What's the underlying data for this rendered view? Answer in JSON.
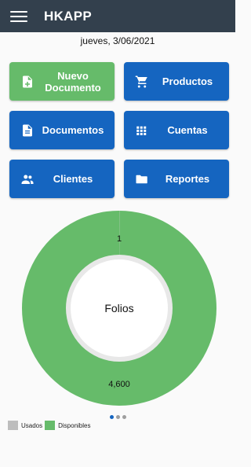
{
  "appbar": {
    "title": "HKAPP",
    "menu_icon": "hamburger-menu-icon"
  },
  "date": "jueves, 3/06/2021",
  "tiles": [
    {
      "label": "Nuevo Documento",
      "icon": "new-document-icon",
      "color": "#66bb6a"
    },
    {
      "label": "Productos",
      "icon": "shopping-cart-icon",
      "color": "#1565c0"
    },
    {
      "label": "Documentos",
      "icon": "document-icon",
      "color": "#1565c0"
    },
    {
      "label": "Cuentas",
      "icon": "grid-icon",
      "color": "#1565c0"
    },
    {
      "label": "Clientes",
      "icon": "people-icon",
      "color": "#1565c0"
    },
    {
      "label": "Reportes",
      "icon": "folder-icon",
      "color": "#1565c0"
    }
  ],
  "chart_data": {
    "type": "pie",
    "center_label": "Folios",
    "categories": [
      "Usados",
      "Disponibles"
    ],
    "values": [
      1,
      4600
    ],
    "value_labels": [
      "1",
      "4,600"
    ],
    "colors": [
      "#bdbdbd",
      "#66bb6a"
    ],
    "legend": "bottom-left"
  },
  "pager": {
    "pages": 3,
    "active": 0
  }
}
